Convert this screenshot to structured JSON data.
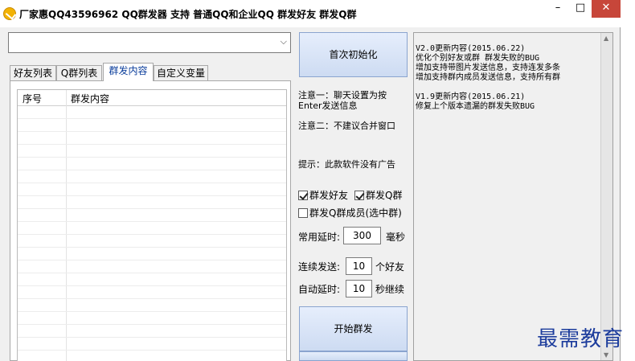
{
  "window": {
    "title": "厂家惠QQ43596962 QQ群发器  支持 普通QQ和企业QQ  群发好友 群发Q群",
    "minimize_glyph": "–",
    "maximize_glyph": "□",
    "close_glyph": "✕",
    "icon": "app-logo-icon"
  },
  "account_select": {
    "value": ""
  },
  "tabs": [
    {
      "label": "好友列表",
      "active": false
    },
    {
      "label": "Q群列表",
      "active": false
    },
    {
      "label": "群发内容",
      "active": true
    },
    {
      "label": "自定义变量",
      "active": false
    }
  ],
  "table": {
    "columns": [
      "序号",
      "群发内容"
    ],
    "rows": []
  },
  "buttons": {
    "init": "首次初始化",
    "start": "开始群发"
  },
  "notes": {
    "note1_line1": "注意一：聊天设置为按",
    "note1_line2": "Enter发送信息",
    "note2": "注意二：不建议合并窗口",
    "hint": "提示：此款软件没有广告"
  },
  "options": {
    "friends": {
      "label": "群发好友",
      "checked": true
    },
    "groups": {
      "label": "群发Q群",
      "checked": true
    },
    "members": {
      "label": "群发Q群成员(选中群)",
      "checked": false
    }
  },
  "settings": {
    "delay_label": "常用延时:",
    "delay_value": "300",
    "delay_unit": "毫秒",
    "continuous_label": "连续发送:",
    "continuous_value": "10",
    "continuous_unit": "个好友",
    "auto_label": "自动延时:",
    "auto_value": "10",
    "auto_unit": "秒继续"
  },
  "changelog": "V2.0更新内容(2015.06.22)\n优化个别好友或群 群发失败的BUG\n增加支持带图片发送信息，支持连发多条\n增加支持群内成员发送信息，支持所有群\n\nV1.9更新内容(2015.06.21)\n修复上个版本遗漏的群发失败BUG",
  "watermark": "最需教育"
}
